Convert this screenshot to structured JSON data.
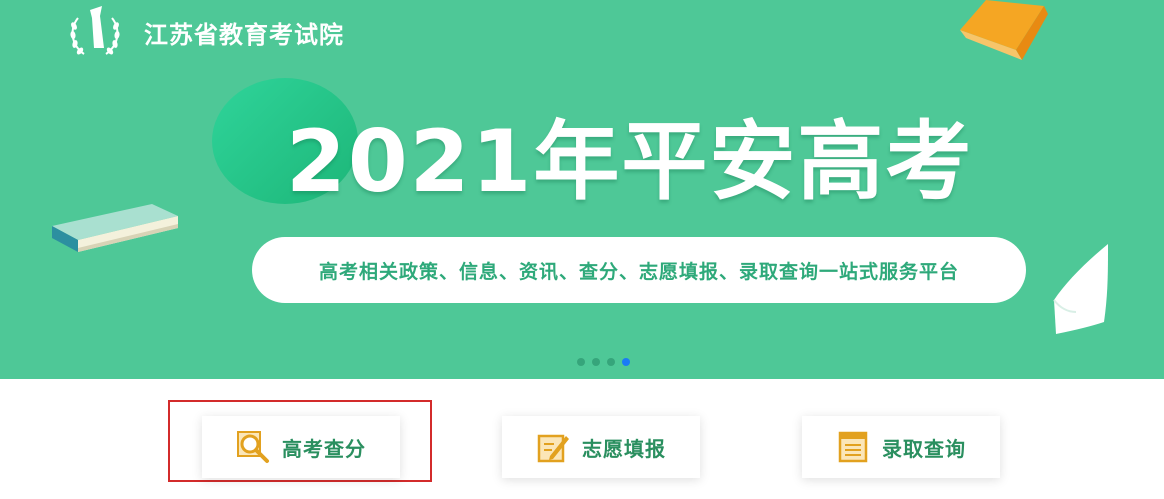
{
  "header": {
    "org_name": "江苏省教育考试院"
  },
  "banner": {
    "headline": "2021年平安高考",
    "tagline": "高考相关政策、信息、资讯、查分、志愿填报、录取查询一站式服务平台",
    "carousel": {
      "slide_count": 4,
      "active_index": 3
    }
  },
  "services": [
    {
      "label": "高考查分",
      "icon": "search-score-icon"
    },
    {
      "label": "志愿填报",
      "icon": "edit-form-icon"
    },
    {
      "label": "录取查询",
      "icon": "document-list-icon"
    }
  ],
  "colors": {
    "banner_bg": "#4ec897",
    "accent_green": "#2a8f5f",
    "icon_orange": "#e2a11f",
    "highlight_red": "#d32b2b",
    "active_dot": "#1a7cf5"
  }
}
